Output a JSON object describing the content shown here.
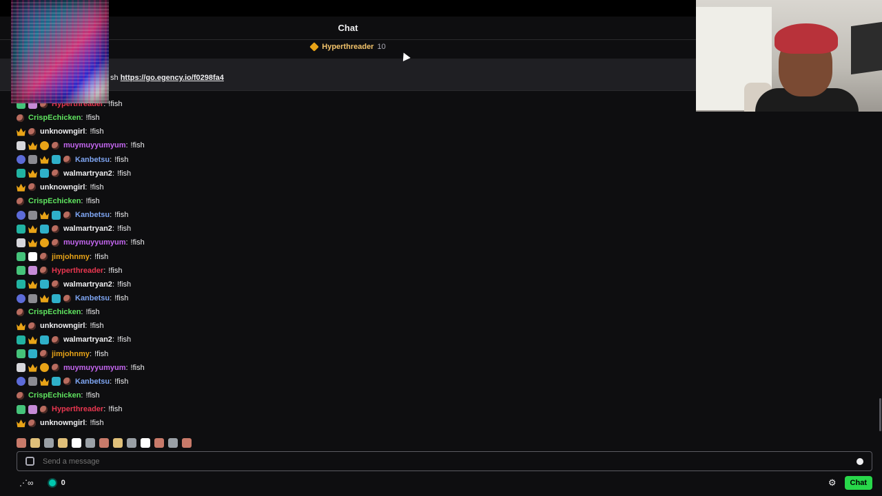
{
  "header": {
    "title": "Chat"
  },
  "leaderboard": {
    "name": "Hyperthreader",
    "count": "10"
  },
  "pinned": {
    "prefix": "sh",
    "link": "https://go.egency.io/f0298fa4"
  },
  "messages": [
    {
      "user": "Hyperthreader",
      "color": "#e8364f",
      "badges": [
        "b-green",
        "b-gift"
      ],
      "text": "!fish"
    },
    {
      "user": "CrispEchicken",
      "color": "#5fe35f",
      "badges": [],
      "text": "!fish"
    },
    {
      "user": "unknowngirl",
      "color": "#efeff1",
      "badges": [
        "b-crown"
      ],
      "text": "!fish"
    },
    {
      "user": "muymuyyumyum",
      "color": "#c466f0",
      "badges": [
        "b-cat",
        "b-crown",
        "b-coin"
      ],
      "text": "!fish"
    },
    {
      "user": "Kanbetsu",
      "color": "#7ea5f2",
      "badges": [
        "b-sub-blue",
        "b-gray",
        "b-crown",
        "b-sparkle"
      ],
      "text": "!fish"
    },
    {
      "user": "walmartryan2",
      "color": "#efeff1",
      "badges": [
        "b-sub-teal",
        "b-crown",
        "b-sparkle"
      ],
      "text": "!fish"
    },
    {
      "user": "unknowngirl",
      "color": "#efeff1",
      "badges": [
        "b-crown"
      ],
      "text": "!fish"
    },
    {
      "user": "CrispEchicken",
      "color": "#5fe35f",
      "badges": [],
      "text": "!fish"
    },
    {
      "user": "Kanbetsu",
      "color": "#7ea5f2",
      "badges": [
        "b-sub-blue",
        "b-gray",
        "b-crown",
        "b-sparkle"
      ],
      "text": "!fish"
    },
    {
      "user": "walmartryan2",
      "color": "#efeff1",
      "badges": [
        "b-sub-teal",
        "b-crown",
        "b-sparkle"
      ],
      "text": "!fish"
    },
    {
      "user": "muymuyyumyum",
      "color": "#c466f0",
      "badges": [
        "b-cat",
        "b-crown",
        "b-coin"
      ],
      "text": "!fish"
    },
    {
      "user": "jimjohnmy",
      "color": "#e8a317",
      "badges": [
        "b-green",
        "b-arrow"
      ],
      "text": "!fish"
    },
    {
      "user": "Hyperthreader",
      "color": "#e8364f",
      "badges": [
        "b-green",
        "b-gift"
      ],
      "text": "!fish"
    },
    {
      "user": "walmartryan2",
      "color": "#efeff1",
      "badges": [
        "b-sub-teal",
        "b-crown",
        "b-sparkle"
      ],
      "text": "!fish"
    },
    {
      "user": "Kanbetsu",
      "color": "#7ea5f2",
      "badges": [
        "b-sub-blue",
        "b-gray",
        "b-crown",
        "b-sparkle"
      ],
      "text": "!fish"
    },
    {
      "user": "CrispEchicken",
      "color": "#5fe35f",
      "badges": [],
      "text": "!fish"
    },
    {
      "user": "unknowngirl",
      "color": "#efeff1",
      "badges": [
        "b-crown"
      ],
      "text": "!fish"
    },
    {
      "user": "walmartryan2",
      "color": "#efeff1",
      "badges": [
        "b-sub-teal",
        "b-crown",
        "b-sparkle"
      ],
      "text": "!fish"
    },
    {
      "user": "jimjohnmy",
      "color": "#e8a317",
      "badges": [
        "b-green",
        "b-sparkle"
      ],
      "text": "!fish"
    },
    {
      "user": "muymuyyumyum",
      "color": "#c466f0",
      "badges": [
        "b-cat",
        "b-crown",
        "b-coin"
      ],
      "text": "!fish"
    },
    {
      "user": "Kanbetsu",
      "color": "#7ea5f2",
      "badges": [
        "b-sub-blue",
        "b-gray",
        "b-crown",
        "b-sparkle"
      ],
      "text": "!fish"
    },
    {
      "user": "CrispEchicken",
      "color": "#5fe35f",
      "badges": [],
      "text": "!fish"
    },
    {
      "user": "Hyperthreader",
      "color": "#e8364f",
      "badges": [
        "b-green",
        "b-gift"
      ],
      "text": "!fish"
    },
    {
      "user": "unknowngirl",
      "color": "#efeff1",
      "badges": [
        "b-crown"
      ],
      "text": "!fish"
    }
  ],
  "input": {
    "placeholder": "Send a message"
  },
  "footer": {
    "points": "0",
    "chat_button": "Chat"
  }
}
